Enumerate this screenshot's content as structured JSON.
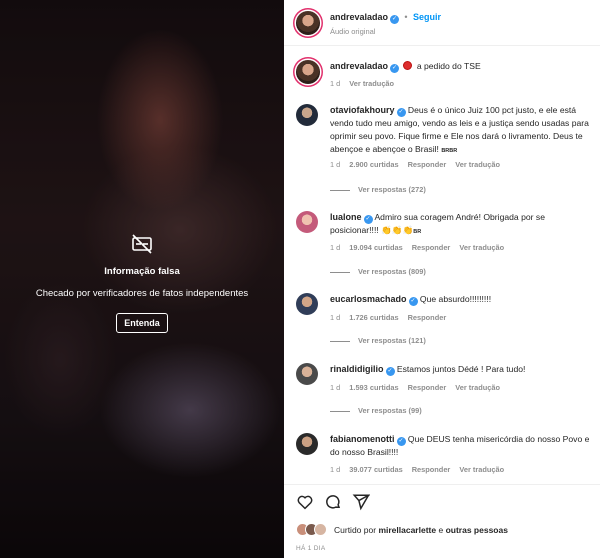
{
  "media": {
    "overlay_title": "Informação falsa",
    "overlay_subtitle": "Checado por verificadores de fatos independentes",
    "overlay_button": "Entenda",
    "icon": "eye-off-icon"
  },
  "header": {
    "username": "andrevaladao",
    "separator": "•",
    "follow_label": "Seguir",
    "audio_label": "Áudio original"
  },
  "caption": {
    "username": "andrevaladao",
    "text": "a pedido do TSE",
    "time": "1 d",
    "translate": "Ver tradução"
  },
  "comments": [
    {
      "username": "otaviofakhoury",
      "text": "Deus é o único Juiz 100 pct justo, e ele está vendo tudo meu amigo, vendo as leis e a justiça sendo usadas para oprimir seu povo. Fique firme e Ele nos dará o livramento. Deus te abençoe e abençoe o Brasil! ",
      "flag": "BRBR",
      "time": "1 d",
      "likes": "2.900 curtidas",
      "reply": "Responder",
      "translate": "Ver tradução",
      "replies": "Ver respostas (272)"
    },
    {
      "username": "lualone",
      "text": "Admiro sua coragem André! Obrigada por se posicionar!!!! 👏👏👏",
      "flag": "BR",
      "time": "1 d",
      "likes": "19.094 curtidas",
      "reply": "Responder",
      "translate": "Ver tradução",
      "replies": "Ver respostas (809)"
    },
    {
      "username": "eucarlosmachado",
      "text": "Que absurdo!!!!!!!!!",
      "time": "1 d",
      "likes": "1.726 curtidas",
      "reply": "Responder",
      "replies": "Ver respostas (121)"
    },
    {
      "username": "rinaldidigilio",
      "text": "Estamos juntos Dédé ! Para tudo!",
      "time": "1 d",
      "likes": "1.593 curtidas",
      "reply": "Responder",
      "translate": "Ver tradução",
      "replies": "Ver respostas (99)"
    },
    {
      "username": "fabianomenotti",
      "text": "Que DEUS tenha misericórdia do nosso Povo e do nosso Brasil!!!!",
      "time": "1 d",
      "likes": "39.077 curtidas",
      "reply": "Responder",
      "translate": "Ver tradução"
    }
  ],
  "footer": {
    "liked_prefix": "Curtido por",
    "liked_user": "mirellacarlette",
    "liked_conj": "e",
    "liked_others": "outras pessoas",
    "date": "HÁ 1 DIA",
    "icons": [
      "heart-icon",
      "comment-icon",
      "share-icon"
    ]
  },
  "colors": {
    "accent": "#0095f6",
    "verified": "#3897f0",
    "muted": "#8e8e8e",
    "text": "#262626"
  }
}
